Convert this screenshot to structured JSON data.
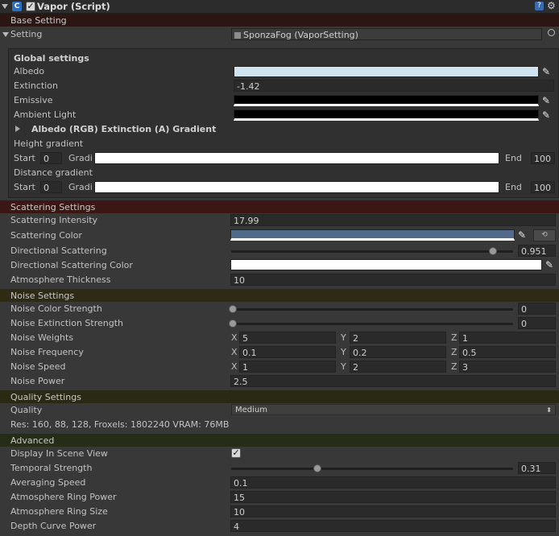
{
  "component": {
    "title": "Vapor (Script)",
    "enabled": true
  },
  "sections": {
    "base": "Base Setting",
    "scattering": "Scattering Settings",
    "noise": "Noise Settings",
    "quality": "Quality Settings",
    "advanced": "Advanced"
  },
  "colors": {
    "base_header": "#2b1614",
    "scattering_header": "#3a1712",
    "noise_header": "#2d2a16",
    "quality_header": "#2a2914",
    "advanced_header": "#262d16",
    "albedo": "#cfe4ee",
    "emissive": "#000000",
    "ambient": "#000000",
    "scattering_color": "#506a8a",
    "directional_color": "#ffffff"
  },
  "setting": {
    "label": "Setting",
    "value": "SponzaFog (VaporSetting)"
  },
  "global": {
    "heading": "Global settings",
    "albedo_label": "Albedo",
    "extinction_label": "Extinction",
    "extinction_value": "-1.42",
    "emissive_label": "Emissive",
    "ambient_label": "Ambient Light",
    "gradient_foldout": "Albedo (RGB) Extinction (A) Gradient",
    "height_gradient": "Height gradient",
    "distance_gradient": "Distance gradient",
    "start_label": "Start",
    "gradient_label": "Gradi",
    "end_label": "End",
    "height_start": "0",
    "height_end": "100",
    "distance_start": "0",
    "distance_end": "100"
  },
  "scattering": {
    "intensity_label": "Scattering Intensity",
    "intensity_value": "17.99",
    "color_label": "Scattering Color",
    "directional_label": "Directional Scattering",
    "directional_value": "0.951",
    "directional_fraction": 0.951,
    "directional_color_label": "Directional Scattering Color",
    "thickness_label": "Atmosphere Thickness",
    "thickness_value": "10"
  },
  "noise": {
    "color_strength_label": "Noise Color Strength",
    "color_strength_value": "0",
    "extinction_strength_label": "Noise Extinction Strength",
    "extinction_strength_value": "0",
    "weights_label": "Noise Weights",
    "weights": {
      "x": "5",
      "y": "2",
      "z": "1"
    },
    "frequency_label": "Noise Frequency",
    "frequency": {
      "x": "0.1",
      "y": "0.2",
      "z": "0.5"
    },
    "speed_label": "Noise Speed",
    "speed": {
      "x": "1",
      "y": "2",
      "z": "3"
    },
    "power_label": "Noise Power",
    "power_value": "2.5"
  },
  "axes": {
    "x": "X",
    "y": "Y",
    "z": "Z"
  },
  "quality": {
    "label": "Quality",
    "value": "Medium",
    "info": "Res: 160, 88, 128, Froxels: 1802240 VRAM: 76MB"
  },
  "advanced": {
    "display_label": "Display In Scene View",
    "display_checked": true,
    "temporal_label": "Temporal Strength",
    "temporal_value": "0.31",
    "temporal_fraction": 0.31,
    "averaging_label": "Averaging Speed",
    "averaging_value": "0.1",
    "ring_power_label": "Atmosphere Ring Power",
    "ring_power_value": "15",
    "ring_size_label": "Atmosphere Ring Size",
    "ring_size_value": "10",
    "depth_label": "Depth Curve Power",
    "depth_value": "4"
  }
}
